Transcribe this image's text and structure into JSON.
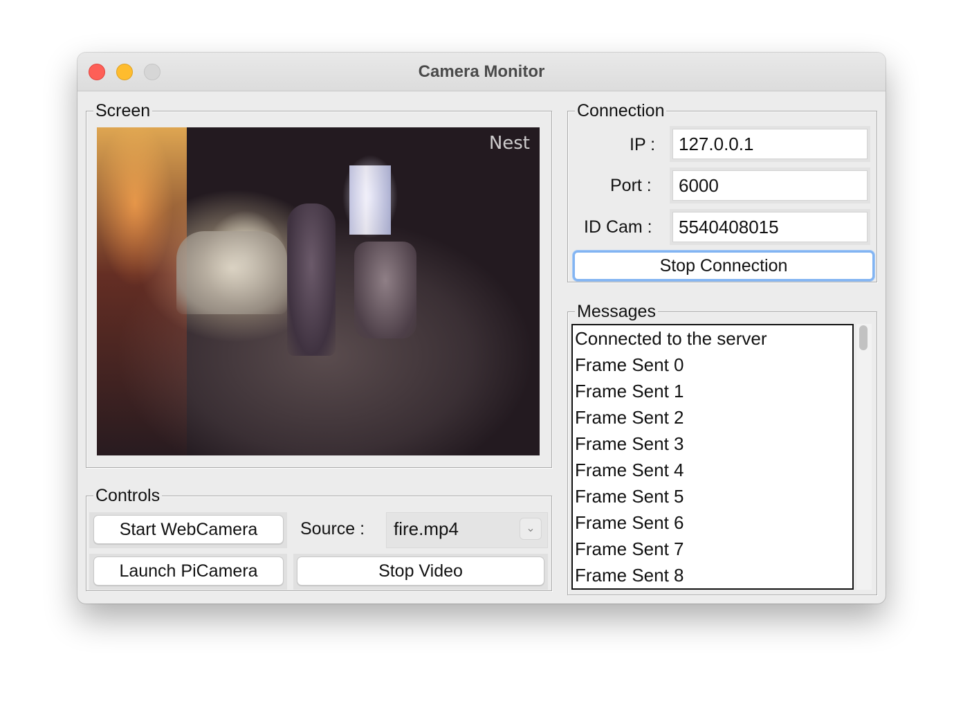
{
  "window": {
    "title": "Camera Monitor"
  },
  "screen": {
    "label": "Screen",
    "video_watermark": "Nest"
  },
  "controls": {
    "label": "Controls",
    "start_webcam_label": "Start WebCamera",
    "launch_picamera_label": "Launch PiCamera",
    "source_label": "Source :",
    "source_value": "fire.mp4",
    "stop_video_label": "Stop Video"
  },
  "connection": {
    "label": "Connection",
    "ip_label": "IP :",
    "ip_value": "127.0.0.1",
    "port_label": "Port :",
    "port_value": "6000",
    "idcam_label": "ID Cam :",
    "idcam_value": "5540408015",
    "stop_connection_label": "Stop Connection"
  },
  "messages": {
    "label": "Messages",
    "items": [
      "Connected to the server",
      "Frame Sent 0",
      "Frame Sent 1",
      "Frame Sent 2",
      "Frame Sent 3",
      "Frame Sent 4",
      "Frame Sent 5",
      "Frame Sent 6",
      "Frame Sent 7",
      "Frame Sent 8"
    ]
  },
  "icons": {
    "close": "close-icon",
    "minimize": "minimize-icon",
    "zoom": "zoom-icon",
    "dropdown": "chevron-down-icon"
  },
  "colors": {
    "close": "#fe5f57",
    "minimize": "#febc2e",
    "zoom_inactive": "#d6d6d6",
    "focus_ring": "#82b4f2"
  }
}
